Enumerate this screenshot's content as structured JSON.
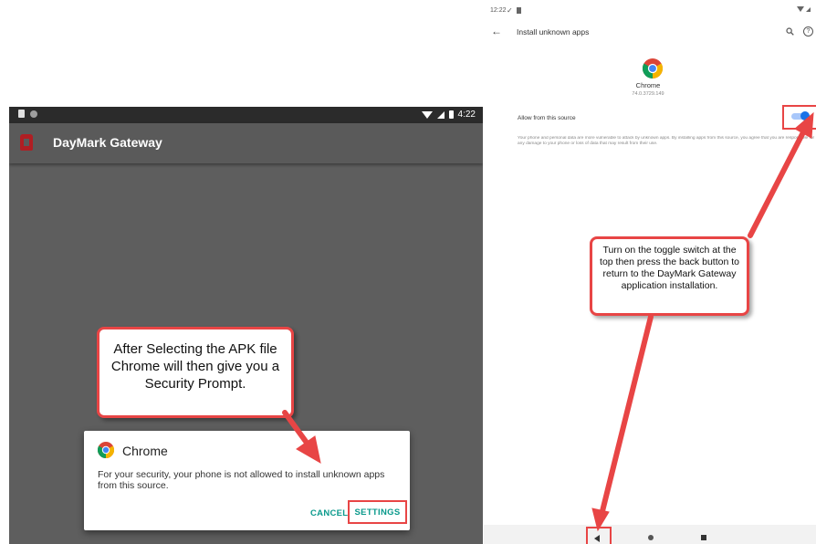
{
  "left": {
    "status_time": "4:22",
    "app_title": "DayMark Gateway",
    "callout_text": "After Selecting the APK file Chrome will then give you a Security Prompt.",
    "dialog": {
      "title": "Chrome",
      "message": "For your security, your phone is not allowed to install unknown apps from this source.",
      "cancel_label": "CANCEL",
      "settings_label": "SETTINGS"
    }
  },
  "right": {
    "status_time": "12:22",
    "page_title": "Install unknown apps",
    "app_name": "Chrome",
    "app_version": "74.0.3729.149",
    "allow_label": "Allow from this source",
    "toggle_on": true,
    "warning_text": "Your phone and personal data are more vulnerable to attack by unknown apps. By installing apps from this source, you agree that you are responsible for any damage to your phone or loss of data that may result from their use.",
    "callout_text": "Turn on the toggle switch at the top then press the back button to return to the DayMark Gateway application installation."
  },
  "colors": {
    "accent_red": "#e84545",
    "teal_button": "#0b9a8c",
    "toggle_blue": "#1a73e8",
    "brand_red": "#b01e23"
  }
}
